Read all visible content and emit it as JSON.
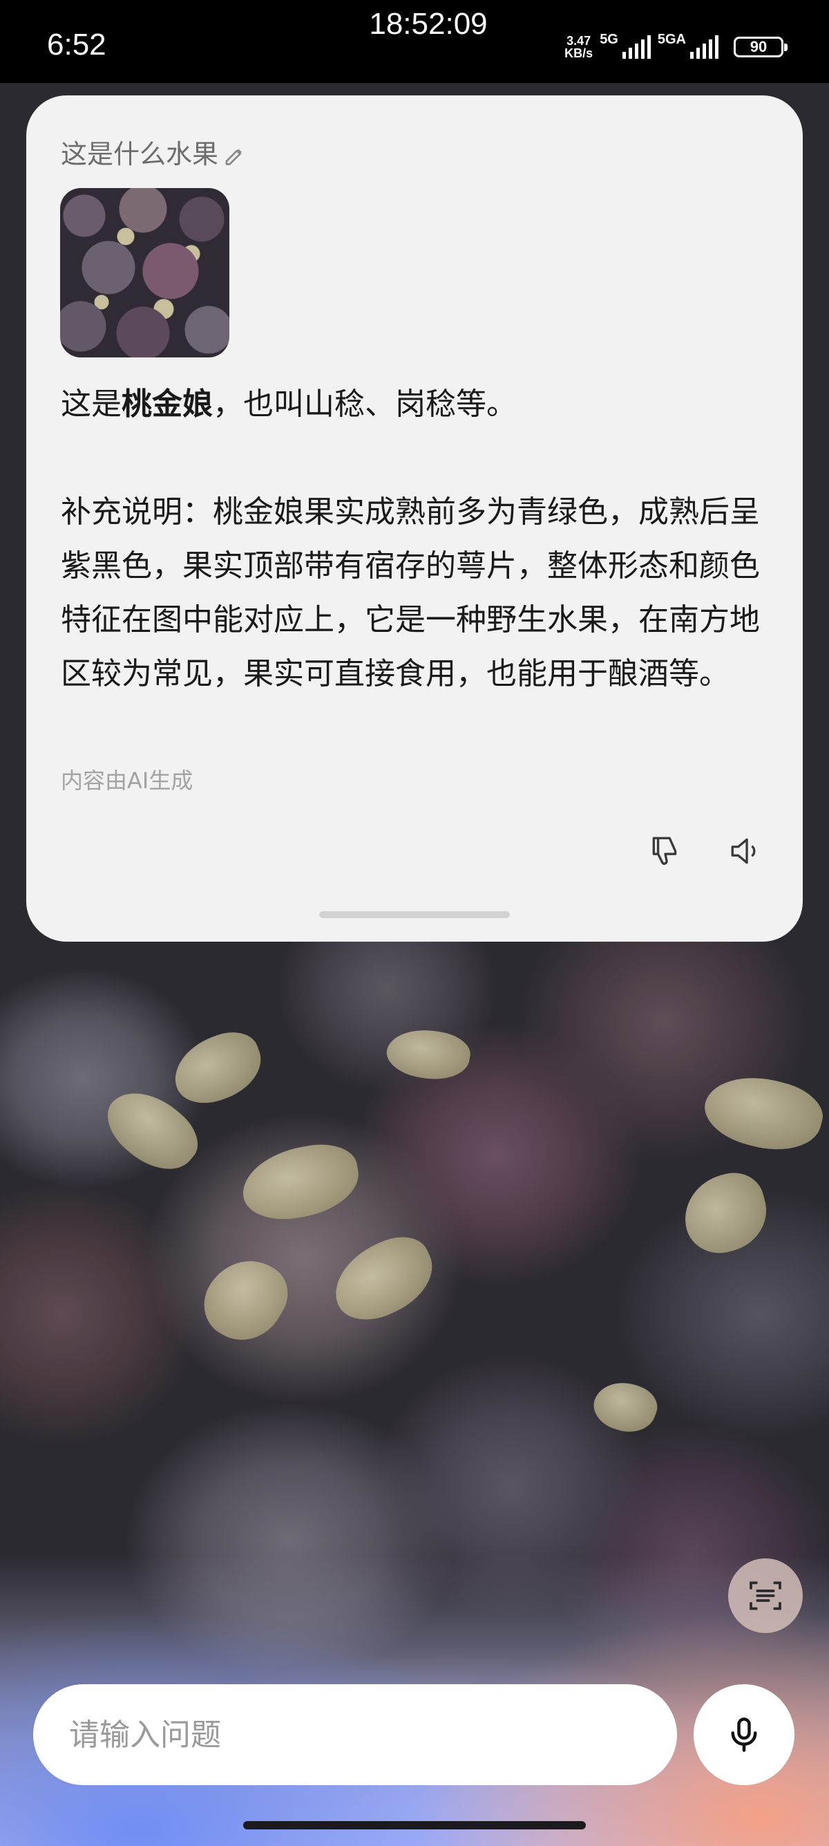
{
  "status_bar": {
    "time": "6:52",
    "clock_overlay": "18:52:09",
    "speed_value": "3.47",
    "speed_unit": "KB/s",
    "network_1": "5G",
    "network_2": "5GA",
    "battery": "90"
  },
  "card": {
    "question": "这是什么水果",
    "answer_prefix": "这是",
    "answer_highlight": "桃金娘",
    "answer_suffix": "，也叫山稔、岗稔等。",
    "supplement": "补充说明：桃金娘果实成熟前多为青绿色，成熟后呈紫黑色，果实顶部带有宿存的萼片，整体形态和颜色特征在图中能对应上，它是一种野生水果，在南方地区较为常见，果实可直接食用，也能用于酿酒等。",
    "ai_note": "内容由AI生成",
    "icons": [
      "pencil-icon",
      "thumbs-down-icon",
      "speaker-icon"
    ]
  },
  "input": {
    "placeholder": "请输入问题",
    "value": ""
  },
  "buttons": {
    "scan_icon": "scan-text-icon",
    "mic_icon": "microphone-icon"
  }
}
